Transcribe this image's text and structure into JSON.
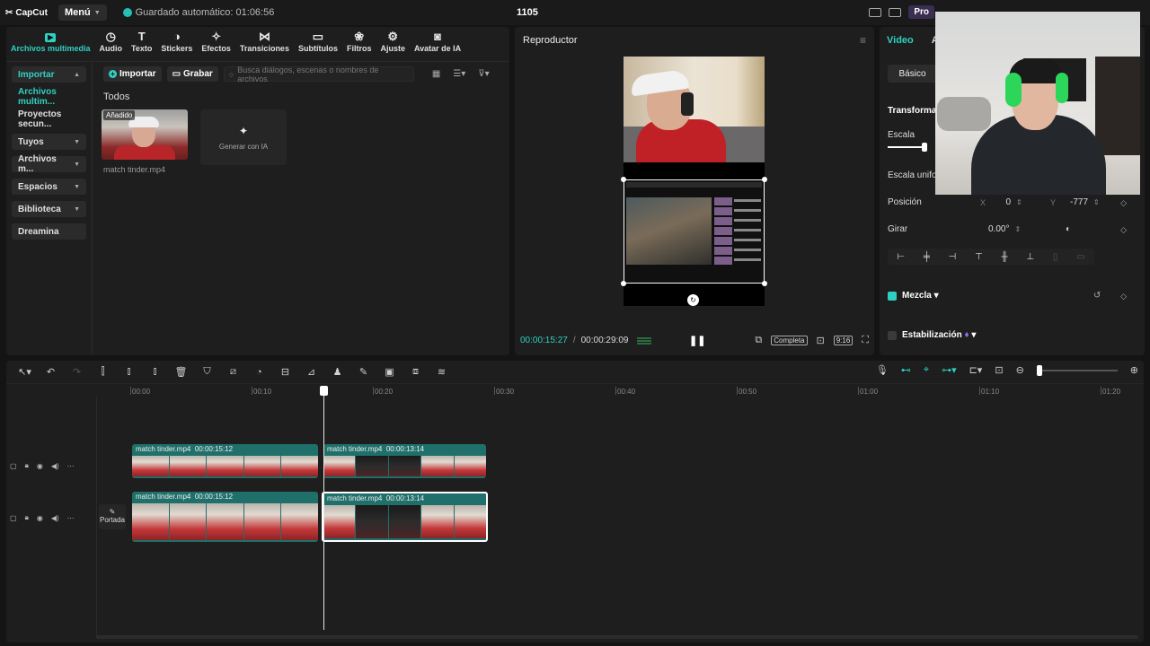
{
  "app": {
    "logo": "CapCut",
    "menu_label": "Menú",
    "autosave": "Guardado automático: 01:06:56",
    "project_title": "1105",
    "pro_label": "Pro"
  },
  "media": {
    "tabs": [
      {
        "label": "Archivos multimedia",
        "icon": "media-icon"
      },
      {
        "label": "Audio",
        "icon": "audio-icon"
      },
      {
        "label": "Texto",
        "icon": "text-icon"
      },
      {
        "label": "Stickers",
        "icon": "sticker-icon"
      },
      {
        "label": "Efectos",
        "icon": "effects-icon"
      },
      {
        "label": "Transiciones",
        "icon": "transitions-icon"
      },
      {
        "label": "Subtítulos",
        "icon": "subtitles-icon"
      },
      {
        "label": "Filtros",
        "icon": "filters-icon"
      },
      {
        "label": "Ajuste",
        "icon": "adjust-icon"
      },
      {
        "label": "Avatar de IA",
        "icon": "ai-avatar-icon"
      }
    ],
    "sidebar": [
      {
        "label": "Importar"
      },
      {
        "label": "Archivos multim..."
      },
      {
        "label": "Proyectos secun..."
      },
      {
        "label": "Tuyos"
      },
      {
        "label": "Archivos m..."
      },
      {
        "label": "Espacios"
      },
      {
        "label": "Biblioteca"
      },
      {
        "label": "Dreamina"
      }
    ],
    "import_label": "Importar",
    "record_label": "Grabar",
    "search_placeholder": "Busca diálogos, escenas o nombres de archivos",
    "section_title": "Todos",
    "item": {
      "badge": "Añadido",
      "name": "match tinder.mp4"
    },
    "generate_label": "Generar con IA"
  },
  "player": {
    "title": "Reproductor",
    "current_time": "00:00:15:27",
    "total_time": "00:00:29:09",
    "fit_label": "Completa",
    "ratio_label": "9:16"
  },
  "props": {
    "tabs": [
      "Video",
      "A"
    ],
    "basic_label": "Básico",
    "transform_title": "Transformac",
    "scale_label": "Escala",
    "uniform_scale_label": "Escala unifor",
    "position_label": "Posición",
    "pos_x_label": "X",
    "pos_x": "0",
    "pos_y_label": "Y",
    "pos_y": "-777",
    "rotate_label": "Girar",
    "rotate_value": "0.00°",
    "blend_label": "Mezcla",
    "stabilize_label": "Estabilización"
  },
  "timeline": {
    "ruler": [
      "00:00",
      "00:10",
      "00:20",
      "00:30",
      "00:40",
      "00:50",
      "01:00",
      "01:10",
      "01:20"
    ],
    "clips": [
      {
        "name": "match tinder.mp4",
        "duration": "00:00:15:12"
      },
      {
        "name": "match tinder.mp4",
        "duration": "00:00:13:14"
      },
      {
        "name": "match tinder.mp4",
        "duration": "00:00:15:12"
      },
      {
        "name": "match tinder.mp4",
        "duration": "00:00:13:14"
      }
    ],
    "cover_label": "Portada"
  }
}
